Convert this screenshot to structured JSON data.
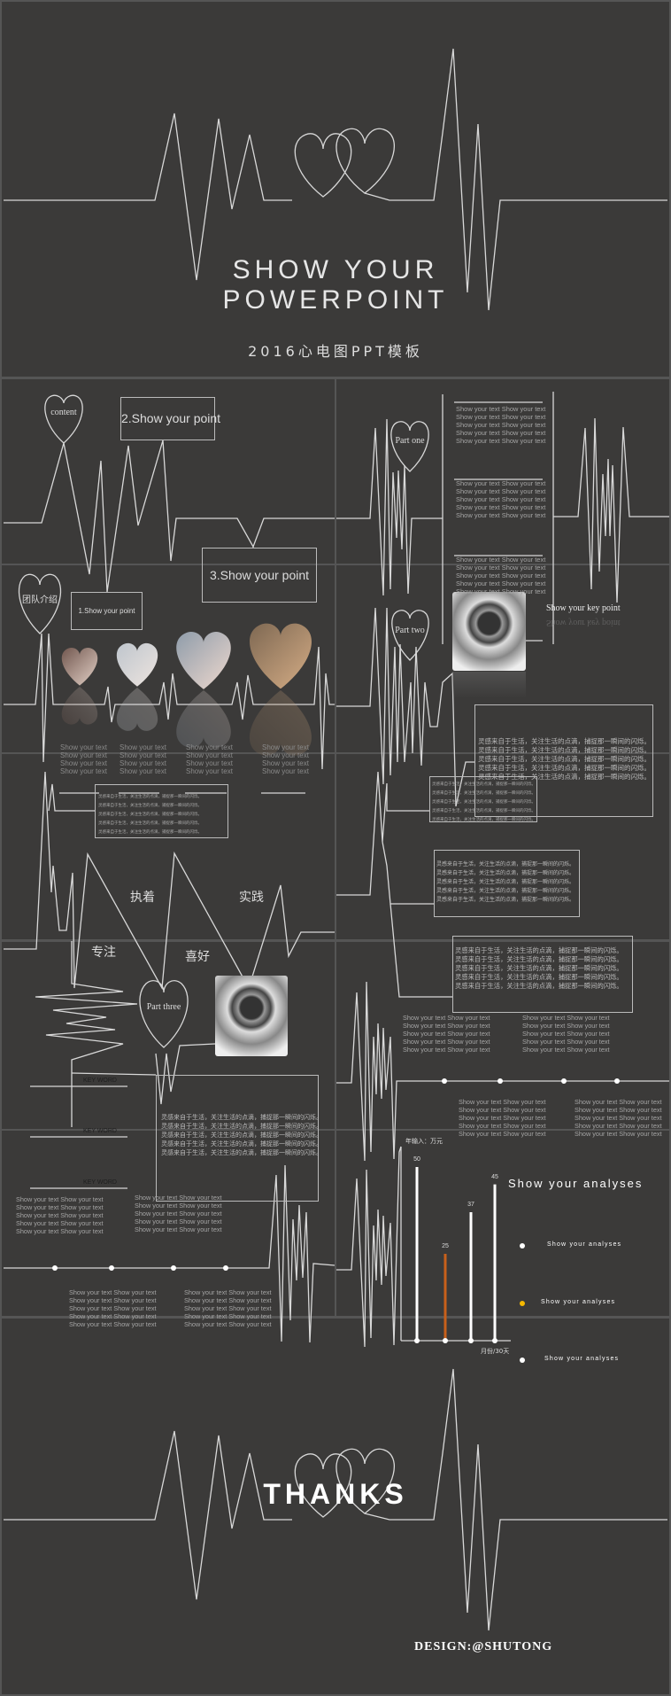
{
  "cover": {
    "title_line1": "SHOW YOUR",
    "title_line2": "POWERPOINT",
    "subtitle": "2016心电图PPT模板"
  },
  "contents": {
    "heart_label": "content",
    "point1": "1.Show your point",
    "point2": "2.Show your point",
    "point3": "3.Show your point"
  },
  "part_one": {
    "heart_label": "Part one",
    "text_line": "Show your text Show your text"
  },
  "team": {
    "heart_label": "团队介绍",
    "member_text": "Show your text"
  },
  "part_two": {
    "heart_label": "Part two",
    "key_point": "Show your key point",
    "body_line": "灵感来自于生活，关注生活的点滴，捕捉那一瞬间的闪烁。"
  },
  "traits": {
    "words": [
      "执着",
      "实践",
      "专注",
      "喜好"
    ]
  },
  "part_three": {
    "heart_label": "Part three",
    "keyword": "KEY WORD"
  },
  "chart_data": {
    "type": "bar",
    "ylabel": "年输入：万元",
    "xlabel": "月份/30天",
    "values": [
      50,
      25,
      37,
      45
    ],
    "data_labels": [
      "50",
      "25",
      "37",
      "45"
    ],
    "highlight_index": 1,
    "colors": {
      "bar": "#ffffff",
      "highlight": "#c8601a"
    },
    "ylim": [
      0,
      55
    ]
  },
  "analyses": {
    "title": "Show your analyses",
    "items": [
      {
        "label": "Show your analyses",
        "color": "#ffffff"
      },
      {
        "label": "Show your analyses",
        "color": "#f5b800"
      },
      {
        "label": "Show your analyses",
        "color": "#ffffff"
      }
    ]
  },
  "closing": {
    "title": "THANKS",
    "credit": "DESIGN:@SHUTONG"
  }
}
